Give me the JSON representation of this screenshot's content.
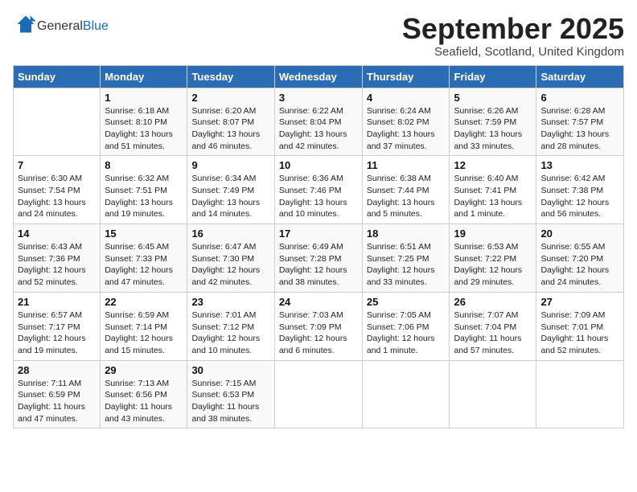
{
  "header": {
    "logo_general": "General",
    "logo_blue": "Blue",
    "month": "September 2025",
    "location": "Seafield, Scotland, United Kingdom"
  },
  "days_of_week": [
    "Sunday",
    "Monday",
    "Tuesday",
    "Wednesday",
    "Thursday",
    "Friday",
    "Saturday"
  ],
  "weeks": [
    [
      {
        "day": "",
        "info": ""
      },
      {
        "day": "1",
        "info": "Sunrise: 6:18 AM\nSunset: 8:10 PM\nDaylight: 13 hours and 51 minutes."
      },
      {
        "day": "2",
        "info": "Sunrise: 6:20 AM\nSunset: 8:07 PM\nDaylight: 13 hours and 46 minutes."
      },
      {
        "day": "3",
        "info": "Sunrise: 6:22 AM\nSunset: 8:04 PM\nDaylight: 13 hours and 42 minutes."
      },
      {
        "day": "4",
        "info": "Sunrise: 6:24 AM\nSunset: 8:02 PM\nDaylight: 13 hours and 37 minutes."
      },
      {
        "day": "5",
        "info": "Sunrise: 6:26 AM\nSunset: 7:59 PM\nDaylight: 13 hours and 33 minutes."
      },
      {
        "day": "6",
        "info": "Sunrise: 6:28 AM\nSunset: 7:57 PM\nDaylight: 13 hours and 28 minutes."
      }
    ],
    [
      {
        "day": "7",
        "info": "Sunrise: 6:30 AM\nSunset: 7:54 PM\nDaylight: 13 hours and 24 minutes."
      },
      {
        "day": "8",
        "info": "Sunrise: 6:32 AM\nSunset: 7:51 PM\nDaylight: 13 hours and 19 minutes."
      },
      {
        "day": "9",
        "info": "Sunrise: 6:34 AM\nSunset: 7:49 PM\nDaylight: 13 hours and 14 minutes."
      },
      {
        "day": "10",
        "info": "Sunrise: 6:36 AM\nSunset: 7:46 PM\nDaylight: 13 hours and 10 minutes."
      },
      {
        "day": "11",
        "info": "Sunrise: 6:38 AM\nSunset: 7:44 PM\nDaylight: 13 hours and 5 minutes."
      },
      {
        "day": "12",
        "info": "Sunrise: 6:40 AM\nSunset: 7:41 PM\nDaylight: 13 hours and 1 minute."
      },
      {
        "day": "13",
        "info": "Sunrise: 6:42 AM\nSunset: 7:38 PM\nDaylight: 12 hours and 56 minutes."
      }
    ],
    [
      {
        "day": "14",
        "info": "Sunrise: 6:43 AM\nSunset: 7:36 PM\nDaylight: 12 hours and 52 minutes."
      },
      {
        "day": "15",
        "info": "Sunrise: 6:45 AM\nSunset: 7:33 PM\nDaylight: 12 hours and 47 minutes."
      },
      {
        "day": "16",
        "info": "Sunrise: 6:47 AM\nSunset: 7:30 PM\nDaylight: 12 hours and 42 minutes."
      },
      {
        "day": "17",
        "info": "Sunrise: 6:49 AM\nSunset: 7:28 PM\nDaylight: 12 hours and 38 minutes."
      },
      {
        "day": "18",
        "info": "Sunrise: 6:51 AM\nSunset: 7:25 PM\nDaylight: 12 hours and 33 minutes."
      },
      {
        "day": "19",
        "info": "Sunrise: 6:53 AM\nSunset: 7:22 PM\nDaylight: 12 hours and 29 minutes."
      },
      {
        "day": "20",
        "info": "Sunrise: 6:55 AM\nSunset: 7:20 PM\nDaylight: 12 hours and 24 minutes."
      }
    ],
    [
      {
        "day": "21",
        "info": "Sunrise: 6:57 AM\nSunset: 7:17 PM\nDaylight: 12 hours and 19 minutes."
      },
      {
        "day": "22",
        "info": "Sunrise: 6:59 AM\nSunset: 7:14 PM\nDaylight: 12 hours and 15 minutes."
      },
      {
        "day": "23",
        "info": "Sunrise: 7:01 AM\nSunset: 7:12 PM\nDaylight: 12 hours and 10 minutes."
      },
      {
        "day": "24",
        "info": "Sunrise: 7:03 AM\nSunset: 7:09 PM\nDaylight: 12 hours and 6 minutes."
      },
      {
        "day": "25",
        "info": "Sunrise: 7:05 AM\nSunset: 7:06 PM\nDaylight: 12 hours and 1 minute."
      },
      {
        "day": "26",
        "info": "Sunrise: 7:07 AM\nSunset: 7:04 PM\nDaylight: 11 hours and 57 minutes."
      },
      {
        "day": "27",
        "info": "Sunrise: 7:09 AM\nSunset: 7:01 PM\nDaylight: 11 hours and 52 minutes."
      }
    ],
    [
      {
        "day": "28",
        "info": "Sunrise: 7:11 AM\nSunset: 6:59 PM\nDaylight: 11 hours and 47 minutes."
      },
      {
        "day": "29",
        "info": "Sunrise: 7:13 AM\nSunset: 6:56 PM\nDaylight: 11 hours and 43 minutes."
      },
      {
        "day": "30",
        "info": "Sunrise: 7:15 AM\nSunset: 6:53 PM\nDaylight: 11 hours and 38 minutes."
      },
      {
        "day": "",
        "info": ""
      },
      {
        "day": "",
        "info": ""
      },
      {
        "day": "",
        "info": ""
      },
      {
        "day": "",
        "info": ""
      }
    ]
  ]
}
